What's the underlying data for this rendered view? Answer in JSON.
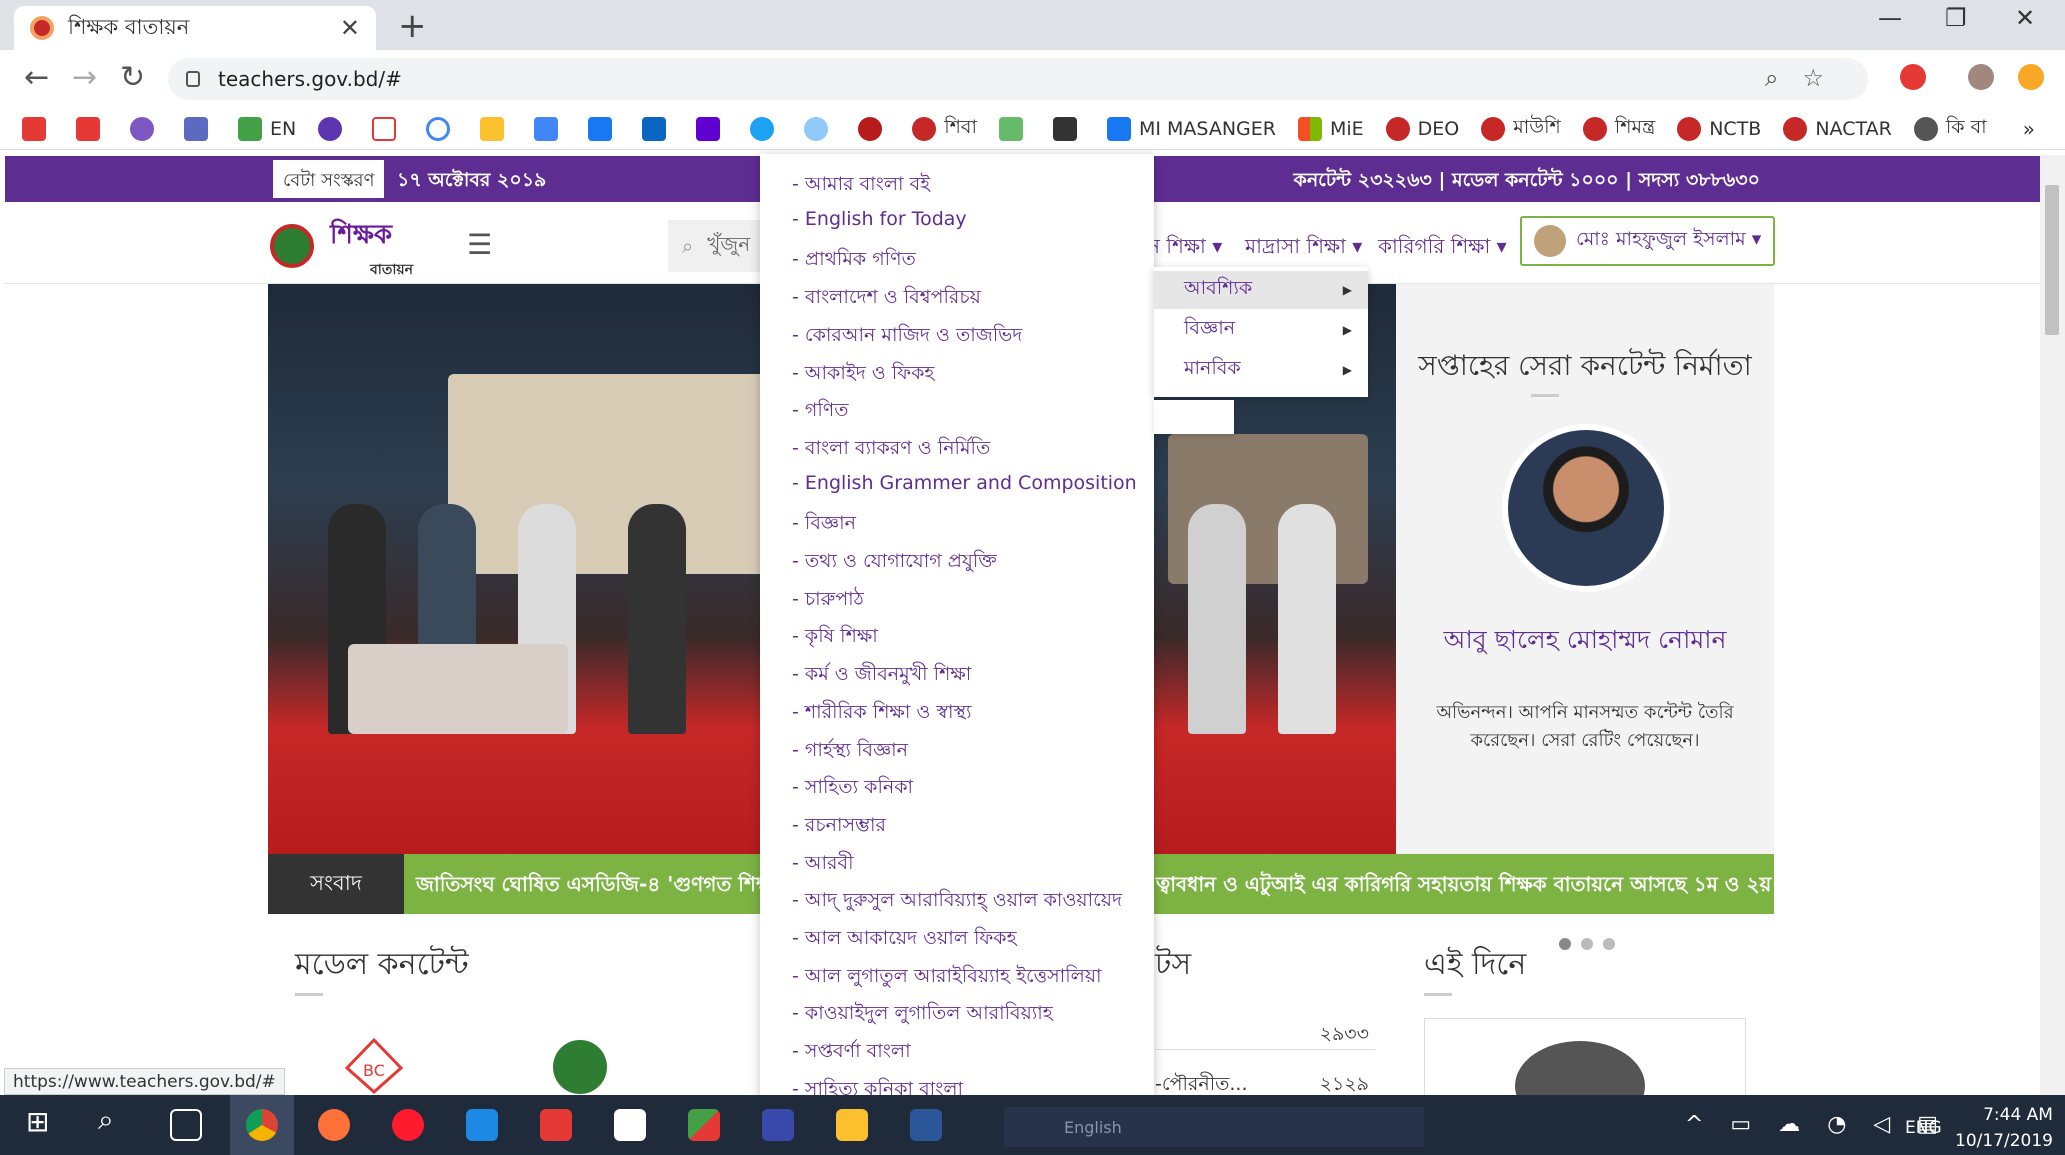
{
  "browser": {
    "tab_title": "শিক্ষক বাতায়ন",
    "url": "teachers.gov.bd/#",
    "status_url": "https://www.teachers.gov.bd/#"
  },
  "bookmarks": [
    "EN",
    "শিবা",
    "MI MASANGER",
    "MiE",
    "DEO",
    "মাউশি",
    "শিমন্ত্র",
    "NCTB",
    "NACTAR",
    "কি বা"
  ],
  "page": {
    "beta_label": "বেটা সংস্করণ",
    "date": "১৭ অক্টোবর ২০১৯",
    "stats": "কনটেন্ট ২৩২২৬৩ | মডেল কনটেন্ট ১০০০ | সদস্য ৩৮৮৬৩০",
    "logo_text": "শিক্ষক",
    "logo_sub": "বাতায়ন",
    "search_placeholder": "খুঁজুন",
    "nav": {
      "general": "ন শিক্ষা ▾",
      "madrasa": "মাদ্রাসা শিক্ষা ▾",
      "technical": "কারিগরি শিক্ষা ▾"
    },
    "user_name": "মোঃ মাহফুজুল ইসলাম ▾",
    "card": {
      "title": "সপ্তাহের সেরা কনটেন্ট নির্মাতা",
      "name": "আবু ছালেহ মোহাম্মদ নোমান",
      "text": "অভিনন্দন। আপনি মানসম্মত কন্টেন্ট তৈরি করেছেন। সেরা রেটিং পেয়েছেন।"
    },
    "news": {
      "label": "সংবাদ",
      "text1": "জাতিসংঘ ঘোষিত এসডিজি-৪ 'গুণগত শিক্ষা'",
      "text2": "ত্বাবধান ও এটুআই এর কারিগরি সহায়তায় শিক্ষক বাতায়নে আসছে ১ম ও ২য় শ্রে"
    },
    "sections": {
      "model_content": "মডেল কনটেন্ট",
      "notice": "টস",
      "this_day": "এই দিনে"
    },
    "notice_rows": [
      {
        "text": "",
        "count": "২৯৩৩"
      },
      {
        "text": "-পৌরনীত...",
        "count": "২১২৯"
      }
    ]
  },
  "dropdown": {
    "items": [
      "- আমার বাংলা বই",
      "- English for Today",
      "- প্রাথমিক গণিত",
      "- বাংলাদেশ ও বিশ্বপরিচয়",
      "- কোরআন মাজিদ ও তাজভিদ",
      "- আকাইদ ও ফিকহ",
      "- গণিত",
      "- বাংলা ব্যাকরণ ও নির্মিতি",
      "- English Grammer and Composition",
      "- বিজ্ঞান",
      "- তথ্য ও যোগাযোগ প্রযুক্তি",
      "- চারুপাঠ",
      "- কৃষি শিক্ষা",
      "- কর্ম ও জীবনমুখী শিক্ষা",
      "- শারীরিক শিক্ষা ও স্বাস্থ্য",
      "- গার্হস্থ্য বিজ্ঞান",
      "- সাহিত্য কনিকা",
      "- রচনাসম্ভার",
      "- আরবী",
      "- আদ্ দুরুসুল আরাবিয়্যাহ্ ওয়াল কাওয়ায়েদ",
      "- আল আকায়েদ ওয়াল ফিকহ",
      "- আল লুগাতুল আরাইবিয়্যাহ ইত্তেসালিয়া",
      "- কাওয়াইদুল লুগাতিল আরাবিয়্যাহ",
      "- সপ্তবর্ণা বাংলা",
      "- সাহিত্য কনিকা বাংলা"
    ]
  },
  "submenu": {
    "items": [
      "আবশ্যিক",
      "বিজ্ঞান",
      "মানবিক"
    ]
  },
  "taskbar": {
    "language_bar": "English",
    "lang": "ENG",
    "time": "7:44 AM",
    "date": "10/17/2019"
  }
}
